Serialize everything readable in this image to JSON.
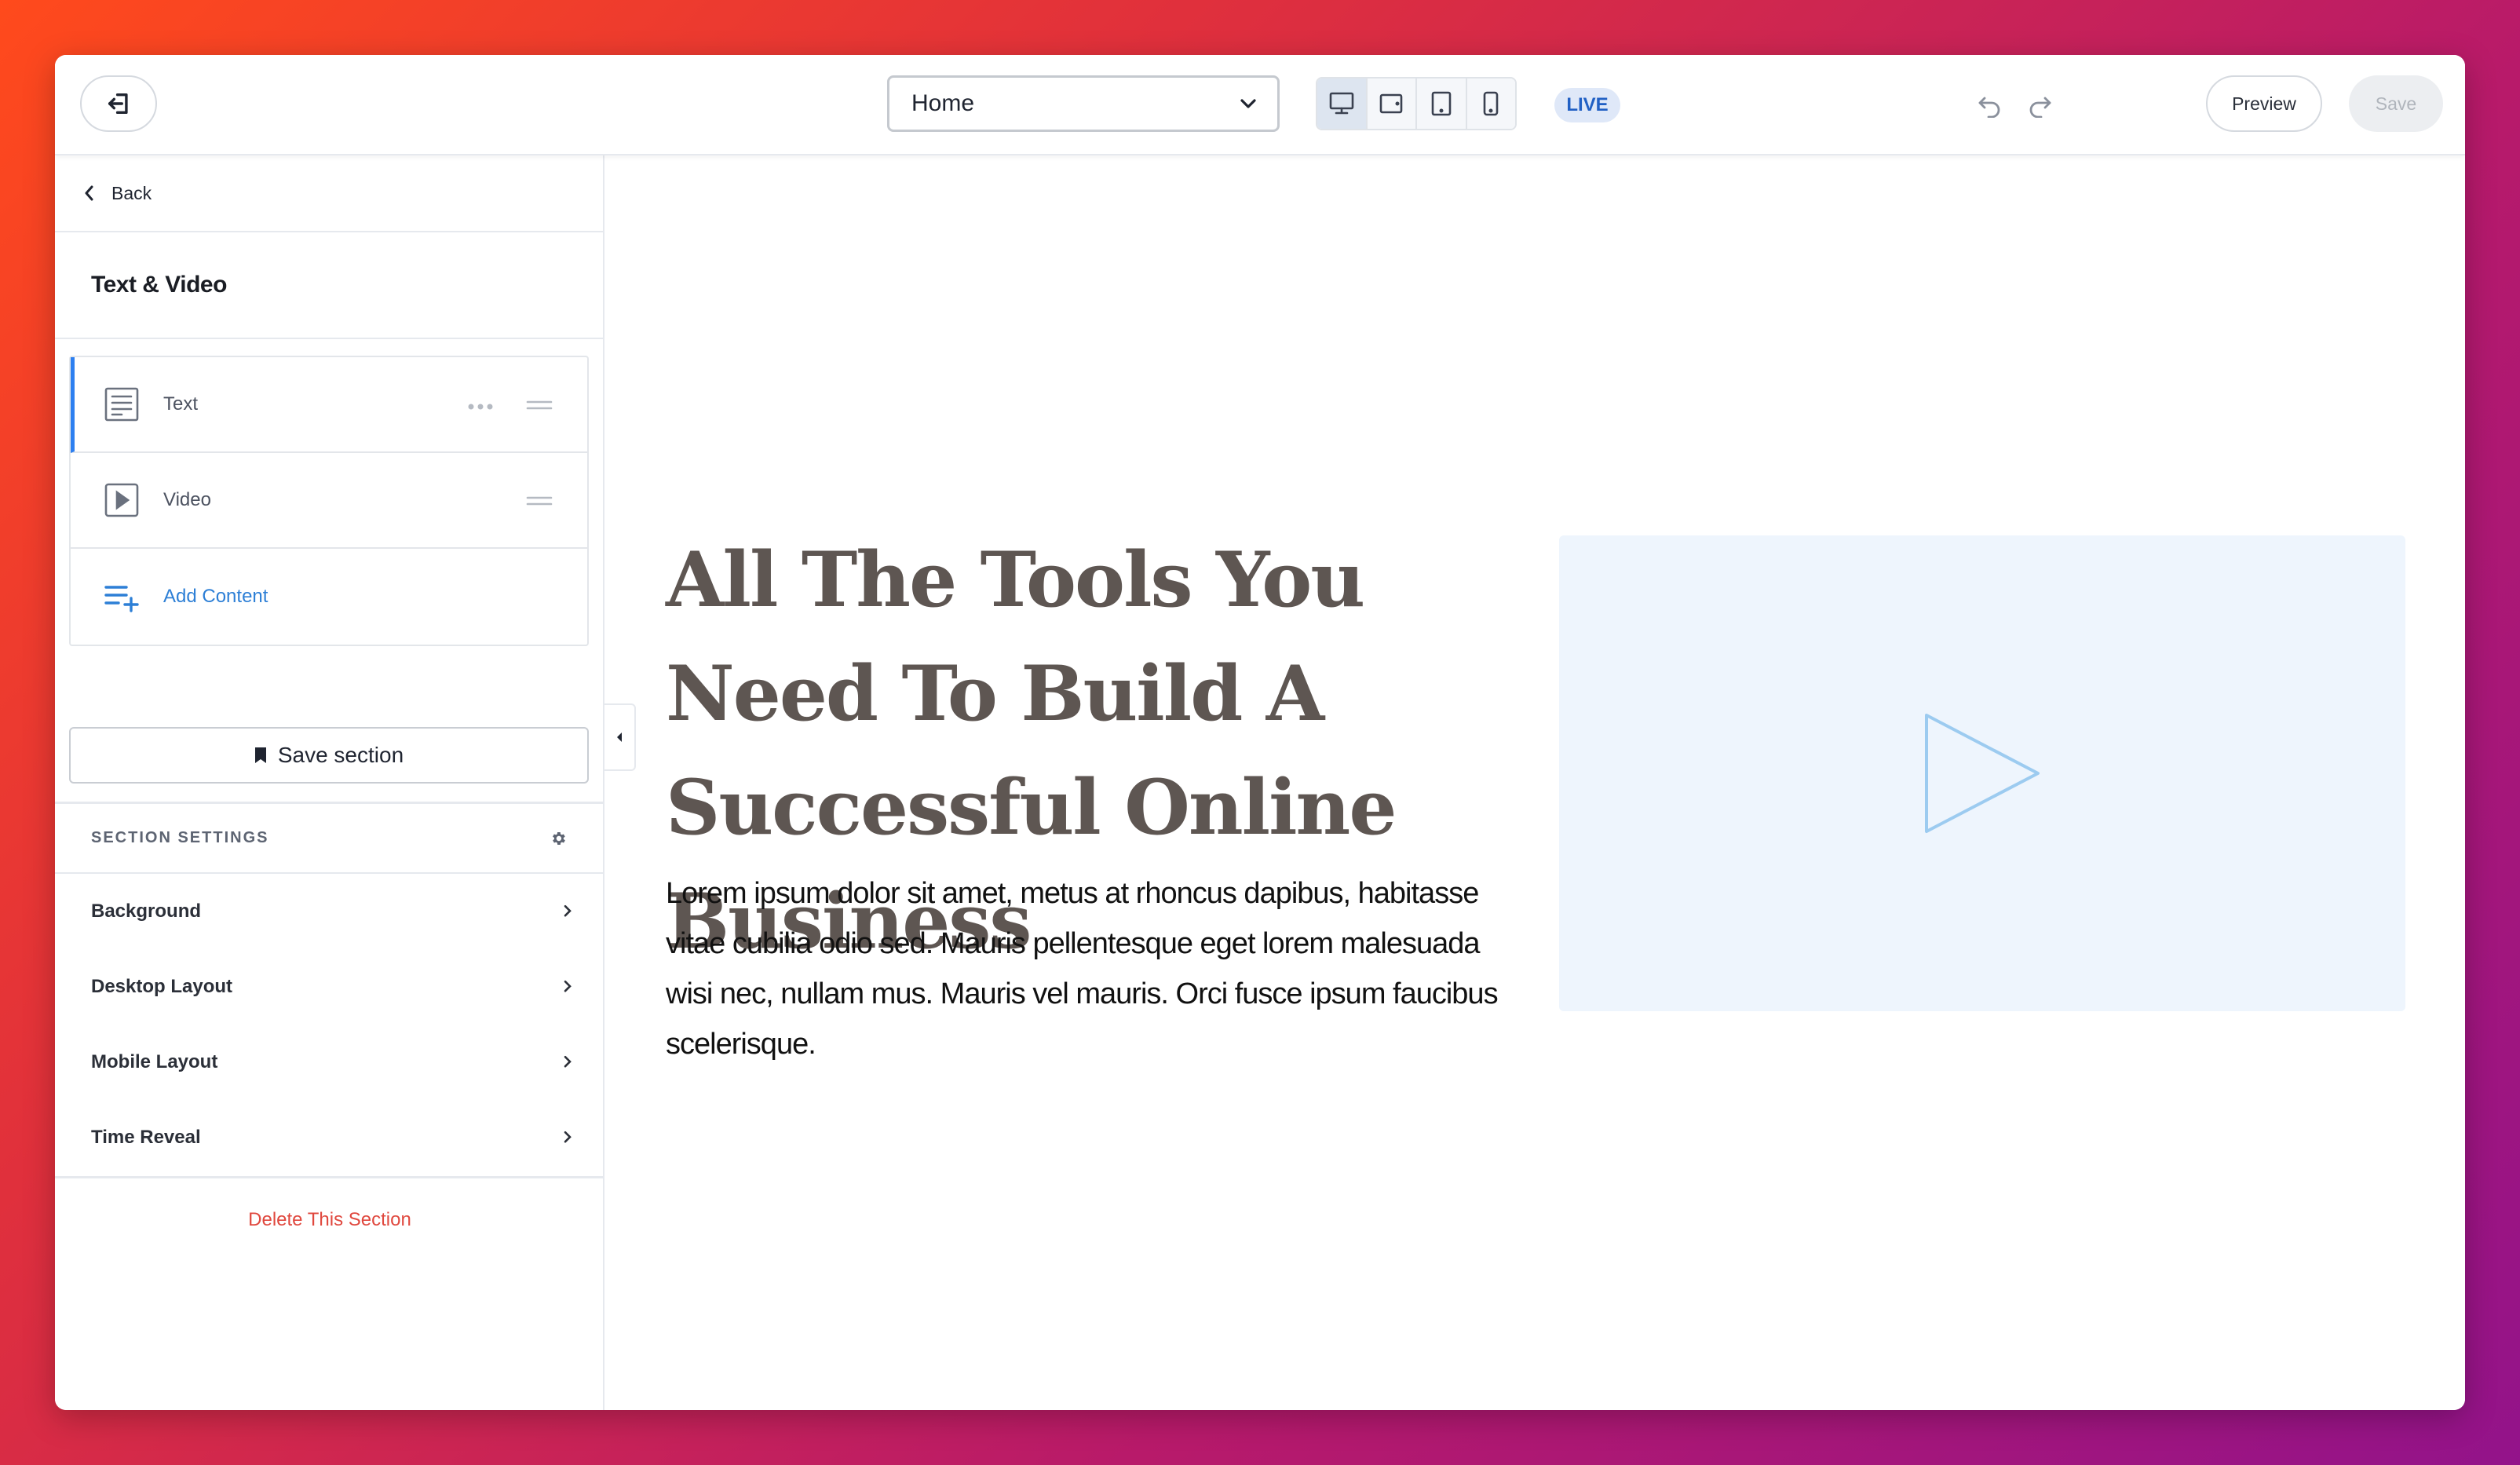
{
  "topbar": {
    "exit_icon": "exit-icon",
    "page_select": {
      "value": "Home"
    },
    "devices": [
      "desktop-icon",
      "tablet-landscape-icon",
      "tablet-portrait-icon",
      "mobile-icon"
    ],
    "active_device": "desktop",
    "live_badge": "LIVE",
    "preview_label": "Preview",
    "save_label": "Save"
  },
  "sidebar": {
    "back_label": "Back",
    "section_title": "Text & Video",
    "content_items": [
      {
        "label": "Text",
        "icon": "text-block-icon"
      },
      {
        "label": "Video",
        "icon": "video-block-icon"
      },
      {
        "label": "Add Content",
        "icon": "add-content-icon"
      }
    ],
    "save_section_label": "Save section",
    "settings_header": "SECTION SETTINGS",
    "settings": [
      {
        "label": "Background"
      },
      {
        "label": "Desktop Layout"
      },
      {
        "label": "Mobile Layout"
      },
      {
        "label": "Time Reveal"
      }
    ],
    "delete_label": "Delete This Section"
  },
  "canvas": {
    "headline": "All The Tools You Need To Build A Successful Online Business",
    "body": "Lorem ipsum dolor sit amet, metus at rhoncus dapibus, habitasse vitae cubilia odio sed. Mauris pellentesque eget lorem malesuada wisi nec, nullam mus. Mauris vel mauris. Orci fusce ipsum faucibus scelerisque."
  },
  "colors": {
    "accent": "#2d7ff0",
    "live_bg": "#dfe8f8",
    "live_text": "#2160c4",
    "delete": "#e0483e",
    "headline": "#5e5652",
    "video_bg": "#eef5fd",
    "play_icon": "#9ccbf0"
  }
}
